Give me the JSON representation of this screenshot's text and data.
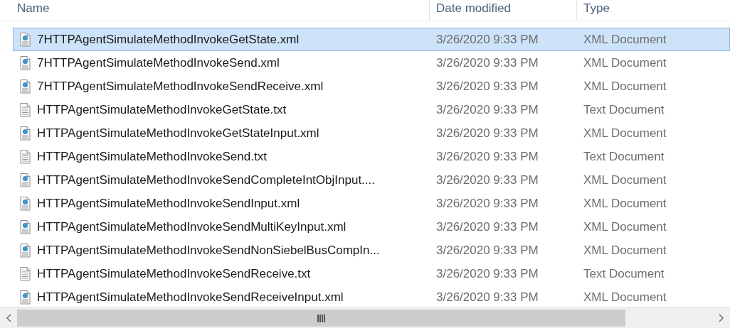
{
  "columns": [
    "Name",
    "Date modified",
    "Type"
  ],
  "files": [
    {
      "name": "7HTTPAgentSimulateMethodInvokeGetState.xml",
      "date": "3/26/2020 9:33 PM",
      "type": "XML Document",
      "kind": "xml",
      "selected": true
    },
    {
      "name": "7HTTPAgentSimulateMethodInvokeSend.xml",
      "date": "3/26/2020 9:33 PM",
      "type": "XML Document",
      "kind": "xml",
      "selected": false
    },
    {
      "name": "7HTTPAgentSimulateMethodInvokeSendReceive.xml",
      "date": "3/26/2020 9:33 PM",
      "type": "XML Document",
      "kind": "xml",
      "selected": false
    },
    {
      "name": "HTTPAgentSimulateMethodInvokeGetState.txt",
      "date": "3/26/2020 9:33 PM",
      "type": "Text Document",
      "kind": "txt",
      "selected": false
    },
    {
      "name": "HTTPAgentSimulateMethodInvokeGetStateInput.xml",
      "date": "3/26/2020 9:33 PM",
      "type": "XML Document",
      "kind": "xml",
      "selected": false
    },
    {
      "name": "HTTPAgentSimulateMethodInvokeSend.txt",
      "date": "3/26/2020 9:33 PM",
      "type": "Text Document",
      "kind": "txt",
      "selected": false
    },
    {
      "name": "HTTPAgentSimulateMethodInvokeSendCompleteIntObjInput....",
      "date": "3/26/2020 9:33 PM",
      "type": "XML Document",
      "kind": "xml",
      "selected": false
    },
    {
      "name": "HTTPAgentSimulateMethodInvokeSendInput.xml",
      "date": "3/26/2020 9:33 PM",
      "type": "XML Document",
      "kind": "xml",
      "selected": false
    },
    {
      "name": "HTTPAgentSimulateMethodInvokeSendMultiKeyInput.xml",
      "date": "3/26/2020 9:33 PM",
      "type": "XML Document",
      "kind": "xml",
      "selected": false
    },
    {
      "name": "HTTPAgentSimulateMethodInvokeSendNonSiebelBusCompIn...",
      "date": "3/26/2020 9:33 PM",
      "type": "XML Document",
      "kind": "xml",
      "selected": false
    },
    {
      "name": "HTTPAgentSimulateMethodInvokeSendReceive.txt",
      "date": "3/26/2020 9:33 PM",
      "type": "Text Document",
      "kind": "txt",
      "selected": false
    },
    {
      "name": "HTTPAgentSimulateMethodInvokeSendReceiveInput.xml",
      "date": "3/26/2020 9:33 PM",
      "type": "XML Document",
      "kind": "xml",
      "selected": false
    }
  ]
}
